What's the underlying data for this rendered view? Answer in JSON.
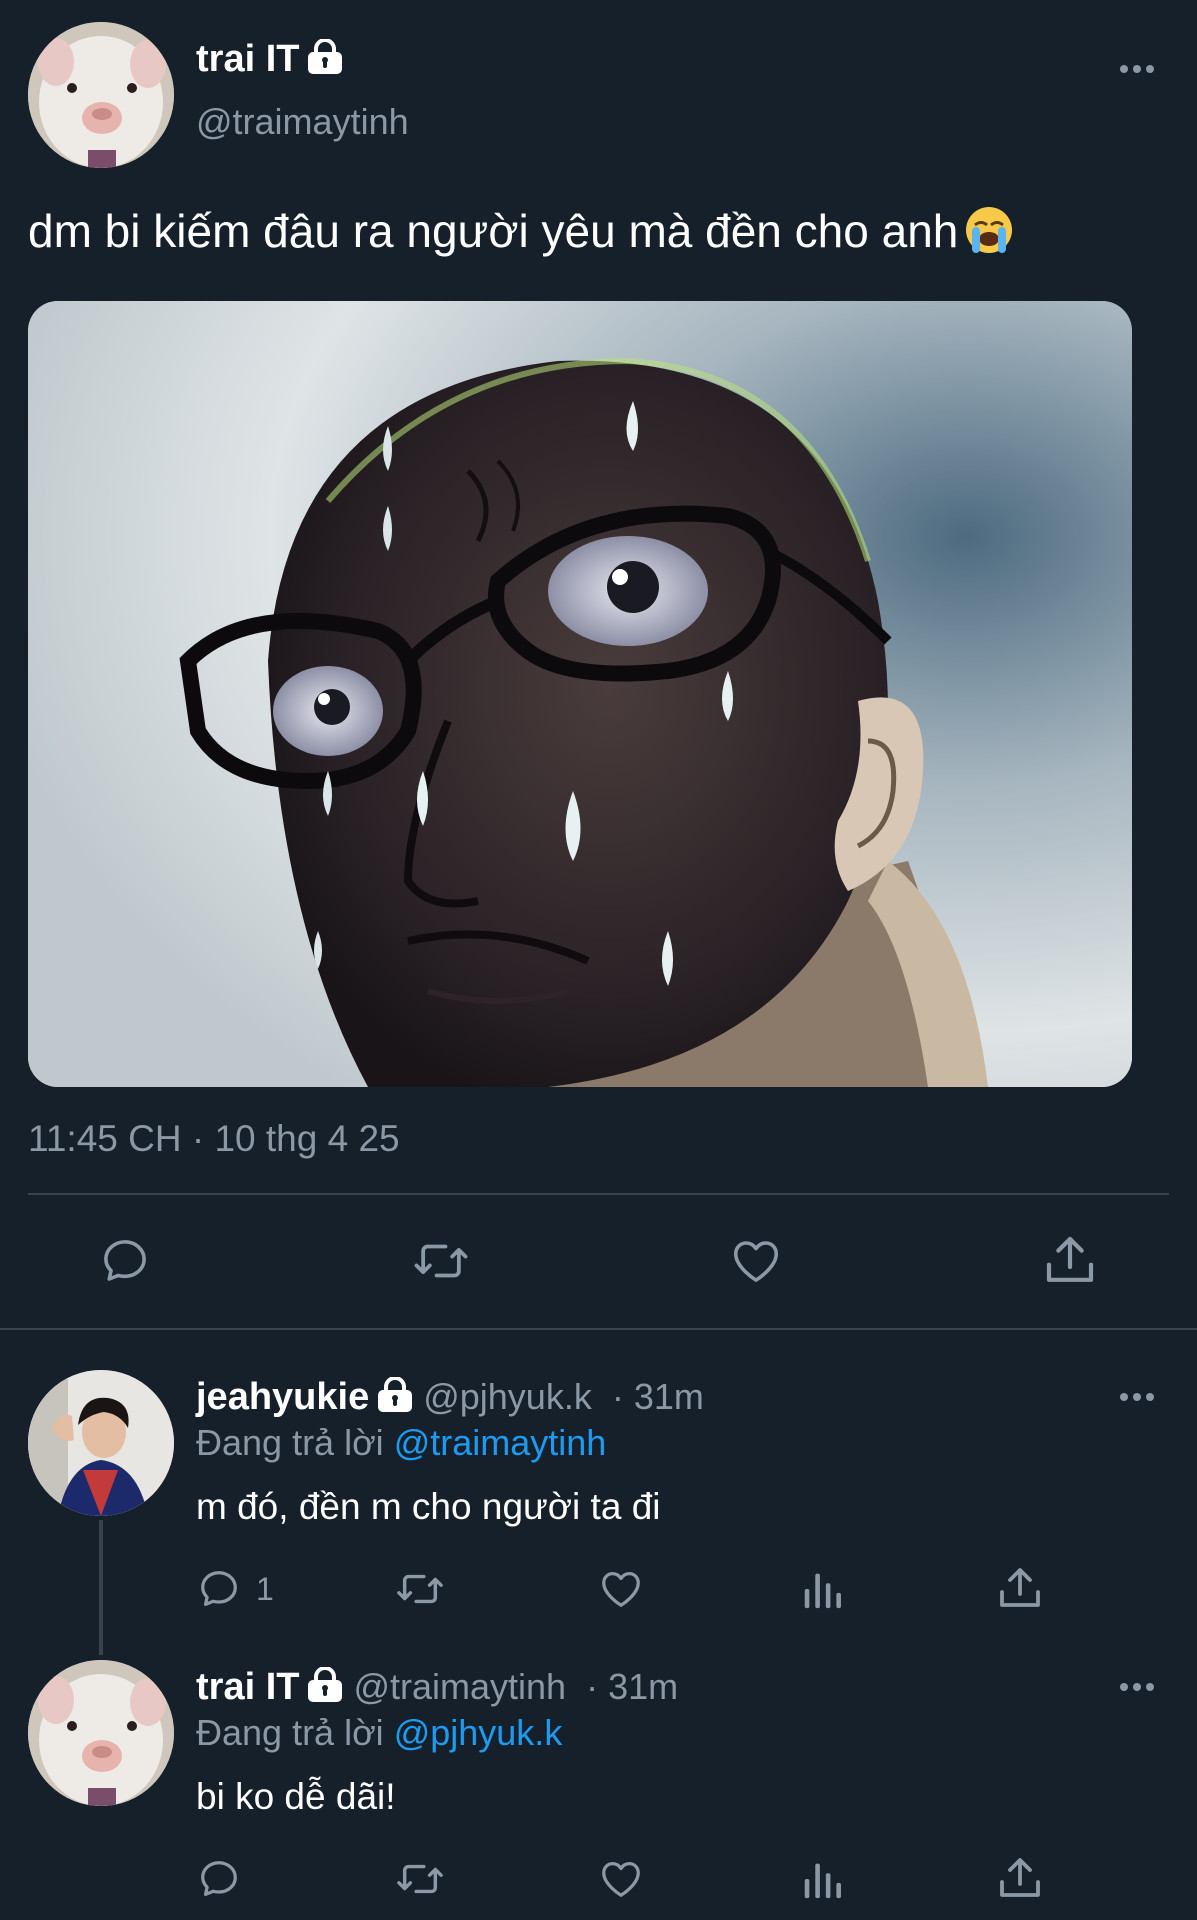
{
  "main_tweet": {
    "author_name": "trai IT",
    "author_handle": "@traimaytinh",
    "text": "dm bi kiếm đâu ra người yêu mà đền cho anh",
    "emoji": "loudly-crying-face",
    "media_description_icon": "anime-sweating-man-image",
    "timestamp": "11:45 CH · 10 thg 4 25",
    "actions": [
      "reply",
      "retweet",
      "like",
      "share"
    ]
  },
  "replies": [
    {
      "author_name": "jeahyukie",
      "author_handle": "@pjhyuk.k",
      "time": "31m",
      "replying_to_prefix": "Đang trả lời",
      "replying_to": "@traimaytinh",
      "text": "m đó, đền m cho người ta đi",
      "reply_count": "1"
    },
    {
      "author_name": "trai IT",
      "author_handle": "@traimaytinh",
      "time": "31m",
      "replying_to_prefix": "Đang trả lời",
      "replying_to": "@pjhyuk.k",
      "text": "bi ko dễ dãi!",
      "reply_count": ""
    }
  ],
  "colors": {
    "background": "#15202b",
    "secondary_text": "#8b98a5",
    "mention": "#1d9bf0",
    "divider": "#38444d"
  }
}
